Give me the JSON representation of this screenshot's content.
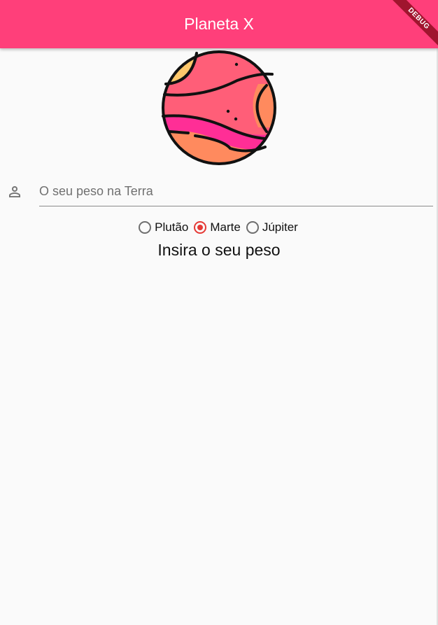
{
  "appbar": {
    "title": "Planeta X",
    "color": "#ff3f7a"
  },
  "debug_banner": {
    "label": "DEBUG"
  },
  "planet": {
    "icon": "planet-icon"
  },
  "weight_input": {
    "icon": "person-icon",
    "placeholder": "O seu peso na Terra",
    "value": ""
  },
  "planets": [
    {
      "label": "Plutão",
      "selected": false
    },
    {
      "label": "Marte",
      "selected": true
    },
    {
      "label": "Júpiter",
      "selected": false
    }
  ],
  "result": {
    "text": "Insira o seu peso"
  },
  "colors": {
    "accent": "#e53935",
    "background": "#fafafa"
  }
}
